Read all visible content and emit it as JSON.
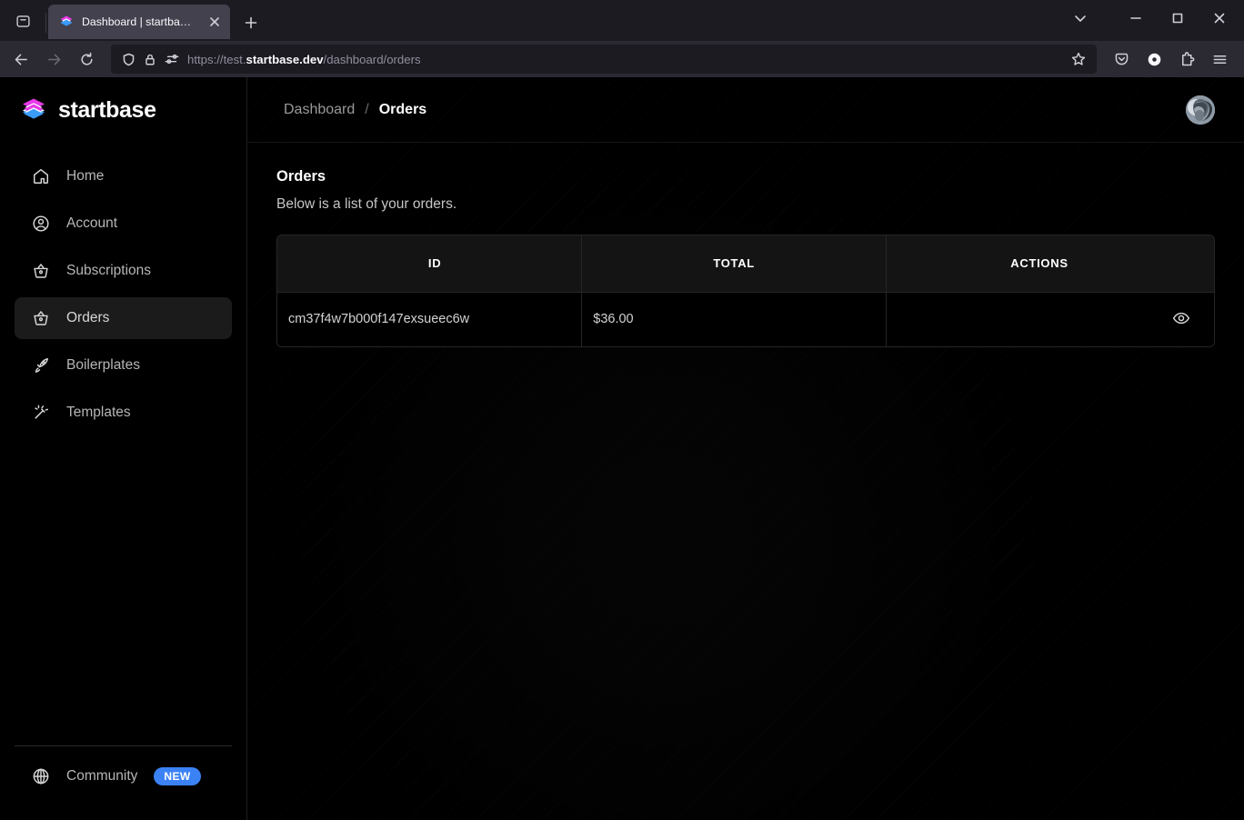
{
  "browser": {
    "tab": {
      "title": "Dashboard | startbase.dev",
      "favicon": "startbase-layers-icon"
    },
    "new_tab_label": "+",
    "url": {
      "scheme": "https://",
      "subdomain": "test.",
      "domain": "startbase.dev",
      "path": "/dashboard/orders",
      "full": "https://test.startbase.dev/dashboard/orders"
    },
    "toolbar_icons": [
      "shield-icon",
      "lock-icon",
      "permissions-icon",
      "bookmark-star-icon",
      "pocket-icon",
      "account-icon",
      "extensions-icon",
      "app-menu-icon"
    ],
    "window_controls": [
      "tab-list-chevron",
      "minimize",
      "maximize",
      "close"
    ]
  },
  "sidebar": {
    "brand": "startbase",
    "items": [
      {
        "label": "Home",
        "icon": "home-icon",
        "active": false
      },
      {
        "label": "Account",
        "icon": "user-circle-icon",
        "active": false
      },
      {
        "label": "Subscriptions",
        "icon": "basket-icon",
        "active": false
      },
      {
        "label": "Orders",
        "icon": "basket-icon",
        "active": true
      },
      {
        "label": "Boilerplates",
        "icon": "rocket-icon",
        "active": false
      },
      {
        "label": "Templates",
        "icon": "magic-wand-icon",
        "active": false
      }
    ],
    "community": {
      "label": "Community",
      "icon": "globe-icon",
      "badge": "NEW",
      "badge_color": "#3b82f6"
    }
  },
  "header": {
    "breadcrumb": {
      "root": "Dashboard",
      "separator": "/",
      "current": "Orders"
    },
    "avatar": "user-avatar"
  },
  "main": {
    "title": "Orders",
    "subtitle": "Below is a list of your orders.",
    "table": {
      "columns": [
        "ID",
        "TOTAL",
        "ACTIONS"
      ],
      "rows": [
        {
          "id": "cm37f4w7b000f147exsueec6w",
          "total": "$36.00",
          "action_icon": "eye-icon"
        }
      ]
    }
  },
  "colors": {
    "accent_pink": "#e838e8",
    "accent_blue": "#3b9bfb",
    "badge_blue": "#3b82f6",
    "page_bg": "#000000"
  }
}
